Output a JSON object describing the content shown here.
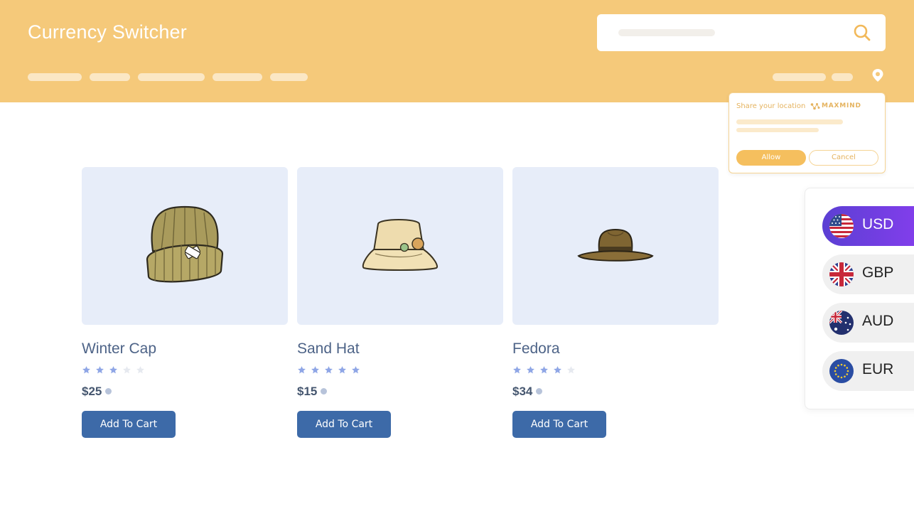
{
  "header": {
    "brand": "Currency Switcher",
    "nav_items": [
      "",
      "",
      "",
      "",
      ""
    ],
    "right_links": [
      "",
      ""
    ]
  },
  "search": {
    "placeholder": ""
  },
  "location_popup": {
    "title": "Share your location",
    "provider": "MAXMIND",
    "allow_label": "Allow",
    "cancel_label": "Cancel"
  },
  "products": [
    {
      "name": "Winter Cap",
      "rating": 3,
      "price": "$25",
      "cta": "Add To Cart",
      "image": "beanie-image"
    },
    {
      "name": "Sand Hat",
      "rating": 5,
      "price": "$15",
      "cta": "Add To Cart",
      "image": "bucket-hat-image"
    },
    {
      "name": "Fedora",
      "rating": 4,
      "price": "$34",
      "cta": "Add To Cart",
      "image": "fedora-image"
    }
  ],
  "currency_switcher": {
    "selected": "USD",
    "options": [
      {
        "code": "USD",
        "flag": "us-flag-icon"
      },
      {
        "code": "GBP",
        "flag": "uk-flag-icon"
      },
      {
        "code": "AUD",
        "flag": "australia-flag-icon"
      },
      {
        "code": "EUR",
        "flag": "eu-flag-icon"
      }
    ]
  },
  "colors": {
    "header_bg": "#f5c97a",
    "card_bg": "#e7edf9",
    "button_bg": "#3d6aa8",
    "star_filled": "#8fa6e6",
    "star_empty": "#e6e9ef",
    "currency_active": "#6a3ee0"
  }
}
